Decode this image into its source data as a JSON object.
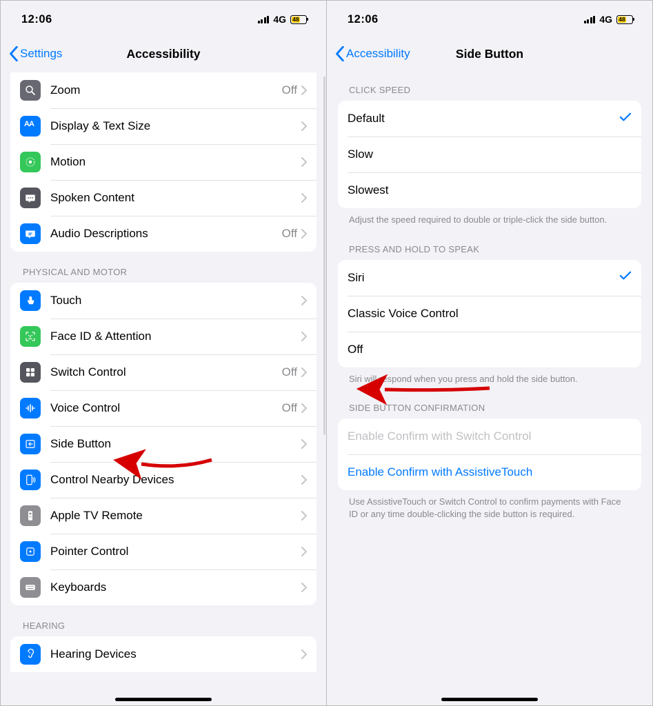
{
  "status": {
    "time": "12:06",
    "network": "4G",
    "battery": "48"
  },
  "left": {
    "back": "Settings",
    "title": "Accessibility",
    "vision_rows": [
      {
        "key": "zoom",
        "label": "Zoom",
        "value": "Off"
      },
      {
        "key": "display",
        "label": "Display & Text Size",
        "value": ""
      },
      {
        "key": "motion",
        "label": "Motion",
        "value": ""
      },
      {
        "key": "spoken",
        "label": "Spoken Content",
        "value": ""
      },
      {
        "key": "audiodesc",
        "label": "Audio Descriptions",
        "value": "Off"
      }
    ],
    "physical_header": "Physical and Motor",
    "physical_rows": [
      {
        "key": "touch",
        "label": "Touch",
        "value": ""
      },
      {
        "key": "faceid",
        "label": "Face ID & Attention",
        "value": ""
      },
      {
        "key": "switch",
        "label": "Switch Control",
        "value": "Off"
      },
      {
        "key": "voice",
        "label": "Voice Control",
        "value": "Off"
      },
      {
        "key": "sidebtn",
        "label": "Side Button",
        "value": ""
      },
      {
        "key": "nearby",
        "label": "Control Nearby Devices",
        "value": ""
      },
      {
        "key": "atv",
        "label": "Apple TV Remote",
        "value": ""
      },
      {
        "key": "pointer",
        "label": "Pointer Control",
        "value": ""
      },
      {
        "key": "keyboards",
        "label": "Keyboards",
        "value": ""
      }
    ],
    "hearing_header": "Hearing",
    "hearing_rows": [
      {
        "key": "hearing",
        "label": "Hearing Devices",
        "value": ""
      }
    ]
  },
  "right": {
    "back": "Accessibility",
    "title": "Side Button",
    "click_header": "Click Speed",
    "click_rows": [
      {
        "key": "default",
        "label": "Default",
        "checked": true
      },
      {
        "key": "slow",
        "label": "Slow",
        "checked": false
      },
      {
        "key": "slowest",
        "label": "Slowest",
        "checked": false
      }
    ],
    "click_footer": "Adjust the speed required to double or triple-click the side button.",
    "hold_header": "Press and Hold to Speak",
    "hold_rows": [
      {
        "key": "siri",
        "label": "Siri",
        "checked": true
      },
      {
        "key": "classic",
        "label": "Classic Voice Control",
        "checked": false
      },
      {
        "key": "off",
        "label": "Off",
        "checked": false
      }
    ],
    "hold_footer": "Siri will respond when you press and hold the side button.",
    "confirm_header": "Side Button Confirmation",
    "confirm_rows": [
      {
        "key": "sc",
        "label": "Enable Confirm with Switch Control",
        "disabled": true
      },
      {
        "key": "at",
        "label": "Enable Confirm with AssistiveTouch",
        "disabled": false
      }
    ],
    "confirm_footer": "Use AssistiveTouch or Switch Control to confirm payments with Face ID or any time double-clicking the side button is required."
  }
}
